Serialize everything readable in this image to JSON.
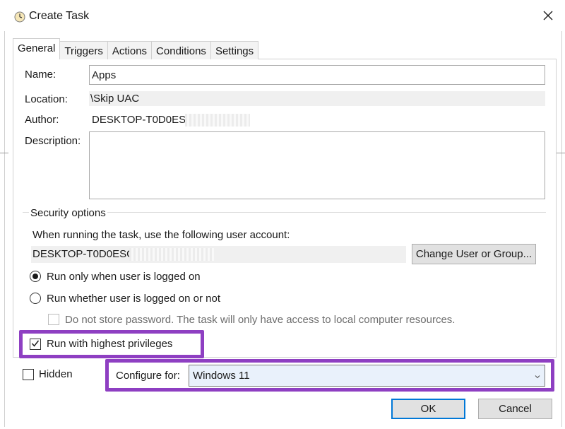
{
  "window": {
    "title": "Create Task",
    "close_glyph": "✕"
  },
  "tabs": [
    {
      "label": "General",
      "active": true
    },
    {
      "label": "Triggers"
    },
    {
      "label": "Actions"
    },
    {
      "label": "Conditions"
    },
    {
      "label": "Settings"
    }
  ],
  "general": {
    "name_label": "Name:",
    "name_value": "Apps",
    "location_label": "Location:",
    "location_value": "\\Skip UAC",
    "author_label": "Author:",
    "author_value": "DESKTOP-T0D0ESG\\",
    "description_label": "Description:",
    "description_value": ""
  },
  "security": {
    "group_title": "Security options",
    "account_prompt": "When running the task, use the following user account:",
    "account_value": "DESKTOP-T0D0ESG\\",
    "change_user_button": "Change User or Group...",
    "run_logged_on": "Run only when user is logged on",
    "run_whether": "Run whether user is logged on or not",
    "do_not_store": "Do not store password.  The task will only have access to local computer resources.",
    "highest_privileges": "Run with highest privileges",
    "selected_radio": "run_logged_on",
    "highest_privileges_checked": true
  },
  "bottom": {
    "hidden_label": "Hidden",
    "hidden_checked": false,
    "configure_label": "Configure for:",
    "configure_value": "Windows 11"
  },
  "buttons": {
    "ok": "OK",
    "cancel": "Cancel"
  },
  "colors": {
    "highlight": "#8e3fc2",
    "ok_border": "#0078d7",
    "select_bg": "#e9f1fb"
  },
  "icons": {
    "title_icon": "clock-icon",
    "close": "close-icon",
    "dropdown": "chevron-down-icon"
  }
}
